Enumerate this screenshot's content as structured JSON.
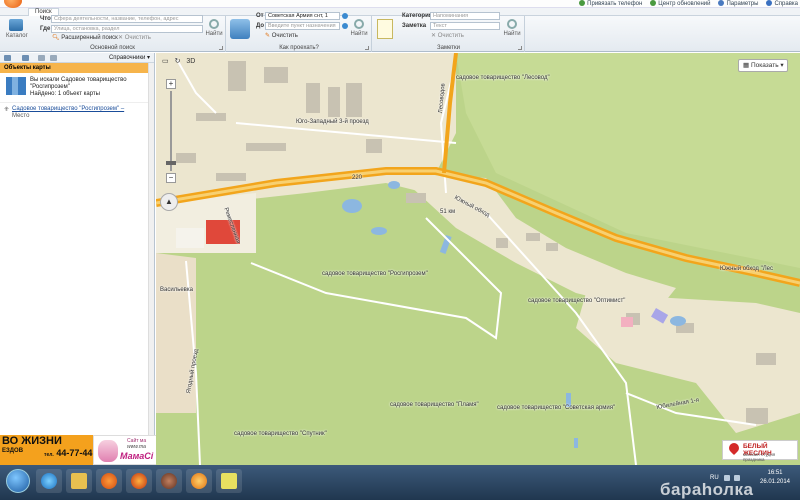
{
  "window": {
    "tab_search": "Поиск",
    "top_links": [
      "Привязать телефон",
      "Центр обновлений",
      "Параметры",
      "Справка"
    ]
  },
  "ribbon": {
    "search": {
      "catalog_label": "Каталог",
      "what_label": "Что",
      "what_placeholder": "Сфера деятельности, название, телефон, адрес",
      "where_label": "Где",
      "where_placeholder": "Улица, остановка, раздел",
      "find_label": "Найти",
      "extended_label": "Расширенный поиск",
      "clear_label": "Очистить",
      "group_title": "Основной поиск"
    },
    "route": {
      "from_label": "От",
      "from_value": "Советская Армия снт, 1",
      "to_label": "До",
      "to_placeholder": "Введите пункт назначения",
      "find_label": "Найти",
      "clear_label": "Очистить",
      "group_title": "Как проехать?"
    },
    "notes": {
      "category_label": "Категория",
      "category_placeholder": "Напоминания",
      "note_label": "Заметка",
      "note_placeholder": "Текст",
      "find_label": "Найти",
      "clear_label": "Очистить",
      "group_title": "Заметки"
    }
  },
  "left_panel": {
    "toolbar_reference": "Справочники",
    "header": "Объекты карты",
    "result_line1": "Вы искали Садовое товарищество",
    "result_line2": "\"Росгипрозем\"",
    "result_line3": "Найдено: 1 объект карты",
    "items": [
      {
        "name": "Садовое товарищество \"Росгипрозем\" –",
        "type": "Место"
      }
    ]
  },
  "ads": {
    "left_big": "ВО ЖИЗНИ",
    "left_line": "ЕЗДОВ",
    "left_phone_prefix": "тел.",
    "left_phone": "44-77-44",
    "right_line1": "Сайт ма",
    "right_line2": "www.ma",
    "right_brand": "МамаСi"
  },
  "map": {
    "tool_3d": "3D",
    "show_button": "Показать",
    "ad_title": "БЕЛЫЙ ЖЕСЛИН",
    "ad_subtitle": "магазин-студия праздника",
    "labels": {
      "pesovod": "садовое товарищество \"Лесовод\"",
      "yugo_zapadny": "Юго-Западный 3-й проезд",
      "yuzhny_obkhod": "Южный обход",
      "yuzhny_obkhod_right": "Южный обход \"Лес",
      "rosgiprozem": "садовое товарищество \"Росгипрозем\"",
      "optimist": "садовое товарищество \"Оптимист\"",
      "plamya": "садовое товарищество \"Пламя\"",
      "sovetskaya": "садовое товарищество \"Советская армия\"",
      "sputnik": "садовое товарищество \"Спутник\"",
      "vasilyevka": "Васильевка",
      "remeslen": "Ремесленная",
      "yubileynaya": "Юбилейная 1-я",
      "lesovod_st": "Лесоводов",
      "yagodny": "Ягодный проезд",
      "no_220": "220",
      "no_51": "51 км"
    }
  },
  "taskbar": {
    "lang": "RU",
    "time": "16:51",
    "date": "26.01.2014",
    "watermark": "бараhолка"
  }
}
